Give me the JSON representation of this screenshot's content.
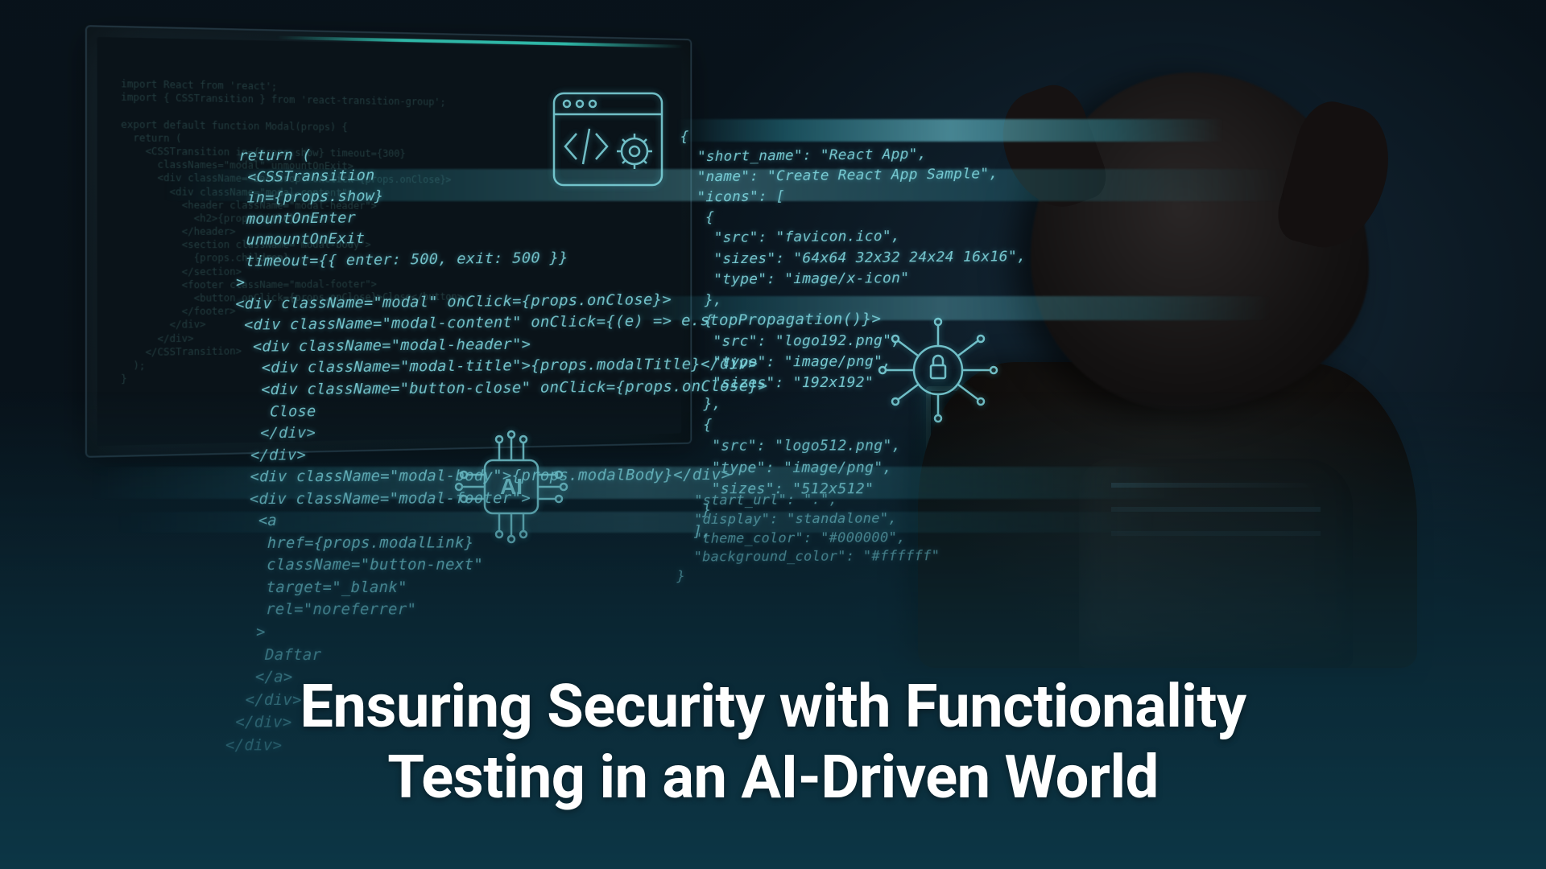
{
  "headline": {
    "line1": "Ensuring Security with Functionality",
    "line2": "Testing in an AI-Driven World"
  },
  "code_left": "  return (\n   <CSSTransition\n   in={props.show}\n   mountOnEnter\n   unmountOnExit\n   timeout={{ enter: 500, exit: 500 }}\n  >\n  <div className=\"modal\" onClick={props.onClose}>\n   <div className=\"modal-content\" onClick={(e) => e.stopPropagation()}>\n    <div className=\"modal-header\">\n     <div className=\"modal-title\">{props.modalTitle}</div>\n     <div className=\"button-close\" onClick={props.onClose}>\n      Close\n     </div>\n    </div>\n    <div className=\"modal-body\">{props.modalBody}</div>\n    <div className=\"modal-footer\">\n     <a\n      href={props.modalLink}\n      className=\"button-next\"\n      target=\"_blank\"\n      rel=\"noreferrer\"\n     >\n      Daftar\n     </a>\n    </div>\n   </div>\n  </div>",
  "code_right": "{\n  \"short_name\": \"React App\",\n  \"name\": \"Create React App Sample\",\n  \"icons\": [\n   {\n    \"src\": \"favicon.ico\",\n    \"sizes\": \"64x64 32x32 24x24 16x16\",\n    \"type\": \"image/x-icon\"\n   },\n   {\n    \"src\": \"logo192.png\",\n    \"type\": \"image/png\",\n    \"sizes\": \"192x192\"\n   },\n   {\n    \"src\": \"logo512.png\",\n    \"type\": \"image/png\",\n    \"sizes\": \"512x512\"\n   }\n  ],",
  "code_right2": "  \"start_url\": \".\",\n  \"display\": \"standalone\",\n  \"theme_color\": \"#000000\",\n  \"background_color\": \"#ffffff\"\n}",
  "monitor_code": "import React from 'react';\nimport { CSSTransition } from 'react-transition-group';\n\nexport default function Modal(props) {\n  return (\n    <CSSTransition in={props.show} timeout={300}\n      classNames=\"modal\" unmountOnExit>\n      <div className=\"backdrop\" onClick={props.onClose}>\n        <div className=\"modal-content\">\n          <header className=\"modal-header\">\n            <h2>{props.title}</h2>\n          </header>\n          <section className=\"modal-body\">\n            {props.children}\n          </section>\n          <footer className=\"modal-footer\">\n            <button onClick={props.onClose}>Close</button>\n          </footer>\n        </div>\n      </div>\n    </CSSTransition>\n  );\n}"
}
